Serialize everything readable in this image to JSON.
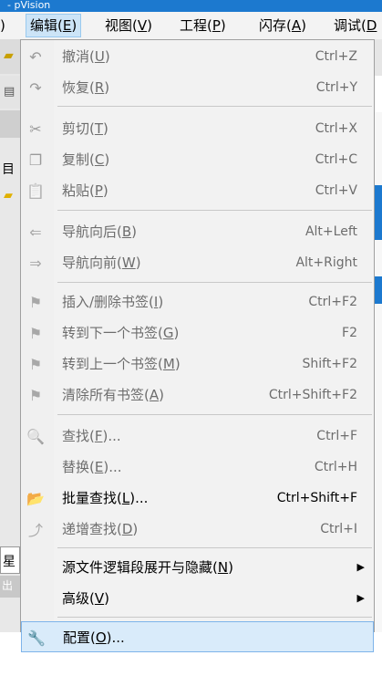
{
  "title_fragment": "- pVision",
  "menubar": {
    "items": [
      {
        "label": "编辑(",
        "accel": "E",
        "close": ")",
        "active": true
      },
      {
        "label": "视图(",
        "accel": "V",
        "close": ")",
        "active": false
      },
      {
        "label": "工程(",
        "accel": "P",
        "close": ")",
        "active": false
      },
      {
        "label": "闪存(",
        "accel": "A",
        "close": ")",
        "active": false
      },
      {
        "label": "调试(",
        "accel": "D",
        "close": "",
        "active": false
      }
    ],
    "left_fragment": ")"
  },
  "left_strip": {
    "text1": "目",
    "text2": "星",
    "text3": "出"
  },
  "menu": {
    "items": [
      {
        "label": "撤消(",
        "accel": "U",
        "close": ")",
        "shortcut": "Ctrl+Z",
        "icon": "undo-icon",
        "glyph": "↶",
        "enabled": false
      },
      {
        "label": "恢复(",
        "accel": "R",
        "close": ")",
        "shortcut": "Ctrl+Y",
        "icon": "redo-icon",
        "glyph": "↷",
        "enabled": false
      },
      {
        "label": "剪切(",
        "accel": "T",
        "close": ")",
        "shortcut": "Ctrl+X",
        "icon": "cut-icon",
        "glyph": "✂",
        "enabled": false
      },
      {
        "label": "复制(",
        "accel": "C",
        "close": ")",
        "shortcut": "Ctrl+C",
        "icon": "copy-icon",
        "glyph": "❐",
        "enabled": false
      },
      {
        "label": "粘贴(",
        "accel": "P",
        "close": ")",
        "shortcut": "Ctrl+V",
        "icon": "paste-icon",
        "glyph": "📋",
        "enabled": false
      },
      {
        "label": "导航向后(",
        "accel": "B",
        "close": ")",
        "shortcut": "Alt+Left",
        "icon": "arrow-left-icon",
        "glyph": "⇐",
        "enabled": false
      },
      {
        "label": "导航向前(",
        "accel": "W",
        "close": ")",
        "shortcut": "Alt+Right",
        "icon": "arrow-right-icon",
        "glyph": "⇒",
        "enabled": false
      },
      {
        "label": "插入/删除书签(",
        "accel": "I",
        "close": ")",
        "shortcut": "Ctrl+F2",
        "icon": "bookmark-toggle-icon",
        "glyph": "⚑",
        "enabled": false
      },
      {
        "label": "转到下一个书签(",
        "accel": "G",
        "close": ")",
        "shortcut": "F2",
        "icon": "bookmark-next-icon",
        "glyph": "⚑",
        "enabled": false
      },
      {
        "label": "转到上一个书签(",
        "accel": "M",
        "close": ")",
        "shortcut": "Shift+F2",
        "icon": "bookmark-prev-icon",
        "glyph": "⚑",
        "enabled": false
      },
      {
        "label": "清除所有书签(",
        "accel": "A",
        "close": ")",
        "shortcut": "Ctrl+Shift+F2",
        "icon": "bookmark-clear-icon",
        "glyph": "⚑",
        "enabled": false
      },
      {
        "label": "查找(",
        "accel": "F",
        "close": ")...",
        "shortcut": "Ctrl+F",
        "icon": "find-icon",
        "glyph": "🔍",
        "enabled": false
      },
      {
        "label": "替换(",
        "accel": "E",
        "close": ")...",
        "shortcut": "Ctrl+H",
        "icon": "",
        "glyph": "",
        "enabled": false
      },
      {
        "label": "批量查找(",
        "accel": "L",
        "close": ")...",
        "shortcut": "Ctrl+Shift+F",
        "icon": "find-in-files-icon",
        "glyph": "📂",
        "enabled": true
      },
      {
        "label": "递增查找(",
        "accel": "D",
        "close": ")",
        "shortcut": "Ctrl+I",
        "icon": "incremental-find-icon",
        "glyph": "⤴",
        "enabled": false
      },
      {
        "label": "源文件逻辑段展开与隐藏(",
        "accel": "N",
        "close": ")",
        "shortcut": "",
        "icon": "",
        "glyph": "",
        "enabled": true,
        "submenu": true
      },
      {
        "label": "高级(",
        "accel": "V",
        "close": ")",
        "shortcut": "",
        "icon": "",
        "glyph": "",
        "enabled": true,
        "submenu": true
      },
      {
        "label": "配置(",
        "accel": "O",
        "close": ")...",
        "shortcut": "",
        "icon": "wrench-icon",
        "glyph": "🔧",
        "enabled": true,
        "highlight": true
      }
    ],
    "submenu_arrow": "▶"
  },
  "colors": {
    "accent": "#1c79cf",
    "highlight": "#d9ebfa",
    "highlight_border": "#7eb4ea",
    "disabled": "#6d6d6d"
  }
}
